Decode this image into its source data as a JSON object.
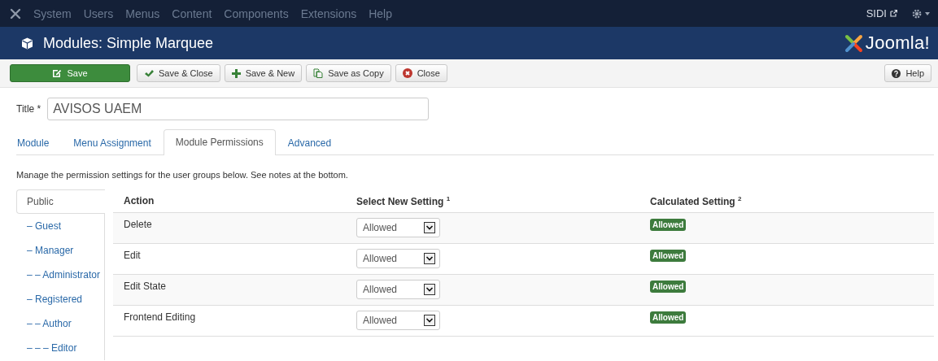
{
  "navbar": {
    "menu": [
      "System",
      "Users",
      "Menus",
      "Content",
      "Components",
      "Extensions",
      "Help"
    ],
    "user": "SIDI"
  },
  "header": {
    "title": "Modules: Simple Marquee",
    "logo_text": "Joomla!"
  },
  "toolbar": {
    "buttons": [
      {
        "kind": "save",
        "label": "Save"
      },
      {
        "kind": "save-close",
        "label": "Save & Close"
      },
      {
        "kind": "save-new",
        "label": "Save & New"
      },
      {
        "kind": "save-copy",
        "label": "Save as Copy"
      },
      {
        "kind": "close",
        "label": "Close"
      }
    ],
    "help": "Help"
  },
  "title_field": {
    "label": "Title *",
    "value": "AVISOS UAEM"
  },
  "tabs": [
    {
      "label": "Module",
      "selected": false
    },
    {
      "label": "Menu Assignment",
      "selected": false
    },
    {
      "label": "Module Permissions",
      "selected": true
    },
    {
      "label": "Advanced",
      "selected": false
    }
  ],
  "description": "Manage the permission settings for the user groups below. See notes at the bottom.",
  "groups": [
    {
      "label": "Public",
      "selected": true,
      "children": [
        {
          "label": "– Guest",
          "selected": false
        },
        {
          "label": "– Manager",
          "selected": false,
          "children": [
            {
              "label": "– – Administrator",
              "selected": false
            }
          ]
        },
        {
          "label": "– Registered",
          "selected": false,
          "children": [
            {
              "label": "– – Author",
              "selected": false,
              "children": [
                {
                  "label": "– – – Editor",
                  "selected": false
                }
              ]
            }
          ]
        }
      ]
    }
  ],
  "table": {
    "columns": [
      "Action",
      "Select New Setting $^{1}$",
      "Calculated Setting $^{2}$"
    ],
    "rows": [
      {
        "action": "Delete",
        "setting": "Allowed",
        "calculated": "Allowed"
      },
      {
        "action": "Edit",
        "setting": "Allowed",
        "calculated": "Allowed"
      },
      {
        "action": "Edit State",
        "setting": "Allowed",
        "calculated": "Allowed"
      },
      {
        "action": "Frontend Editing",
        "setting": "Allowed",
        "calculated": "Allowed"
      }
    ]
  }
}
